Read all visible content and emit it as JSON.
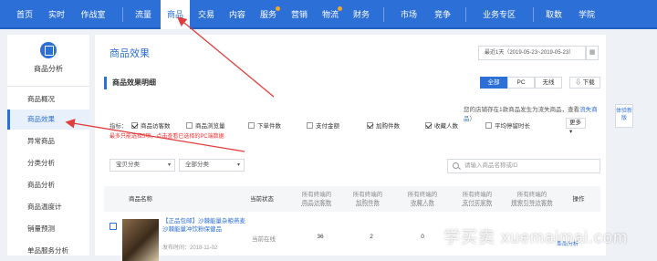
{
  "topnav": {
    "items": [
      "首页",
      "实时",
      "作战室",
      "流量",
      "商品",
      "交易",
      "内容",
      "服务",
      "营销",
      "物流",
      "财务",
      "市场",
      "竞争",
      "业务专区",
      "取数",
      "学院"
    ],
    "active": "商品"
  },
  "sidebar": {
    "app_title": "商品分析",
    "items": [
      "商品概况",
      "商品效果",
      "异常商品",
      "分类分析",
      "商品分析",
      "商品温度计",
      "销量预测",
      "单品服务分析"
    ],
    "active": "商品效果"
  },
  "main": {
    "page_title": "商品效果",
    "date_range": "最近1天（2019-05-23~2019-05-23）",
    "calendar_icon": "calendar-icon",
    "section_title": "商品效果明细",
    "segments": [
      "全部",
      "PC",
      "无线"
    ],
    "download": "下载",
    "info_prefix": "您的店铺存在",
    "info_count": "1",
    "info_mid": "款商品发生为流失商品，查看",
    "info_link": "流失商品",
    "info_suffix": "）",
    "metrics_label": "指标：",
    "metrics": [
      {
        "label": "商品访客数",
        "checked": true
      },
      {
        "label": "商品浏览量",
        "checked": false
      },
      {
        "label": "下单件数",
        "checked": false
      },
      {
        "label": "支付金额",
        "checked": false
      },
      {
        "label": "加购件数",
        "checked": true
      },
      {
        "label": "收藏人数",
        "checked": true
      },
      {
        "label": "平均停留时长",
        "checked": false
      }
    ],
    "more": "更多",
    "warning": "最多只能选择5项，点击查看已选择的PC端数据",
    "filter_category": "宝贝分类",
    "filter_all": "全部分类",
    "search_placeholder": "请输入商品名称或ID",
    "table": {
      "headers": [
        "商品名称",
        "当前状态",
        "商品访客数",
        "加购件数",
        "收藏人数",
        "支付买家数",
        "搜索引导访客数",
        "操作"
      ],
      "header_prefix": "所有终端的",
      "row": {
        "name": "【正品包邮】沙棘能量杂粮燕麦沙棘能量冲饮粉保健品",
        "time": "发布时间：2018-11-02",
        "status": "当前在线",
        "visitors": "36",
        "carts": "2",
        "favorites": "0",
        "action": "单品分析"
      }
    }
  },
  "ext_button": "体验新版",
  "watermark": "学买卖 xuemaimai.com",
  "colors": {
    "accent": "#2c6fd6",
    "arrow": "#e23b3b",
    "warning": "#ee3333"
  }
}
